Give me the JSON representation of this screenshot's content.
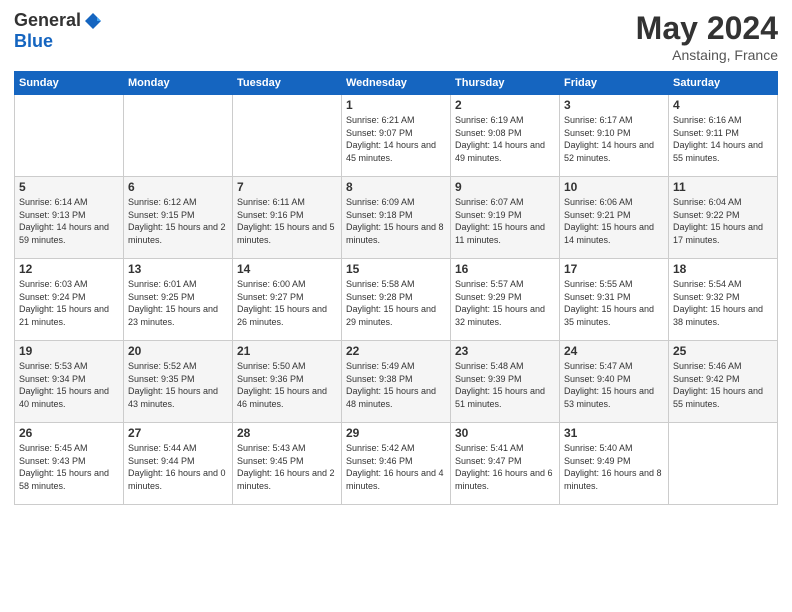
{
  "header": {
    "logo_general": "General",
    "logo_blue": "Blue",
    "title": "May 2024",
    "location": "Anstaing, France"
  },
  "days_of_week": [
    "Sunday",
    "Monday",
    "Tuesday",
    "Wednesday",
    "Thursday",
    "Friday",
    "Saturday"
  ],
  "weeks": [
    [
      {
        "day": "",
        "info": ""
      },
      {
        "day": "",
        "info": ""
      },
      {
        "day": "",
        "info": ""
      },
      {
        "day": "1",
        "info": "Sunrise: 6:21 AM\nSunset: 9:07 PM\nDaylight: 14 hours\nand 45 minutes."
      },
      {
        "day": "2",
        "info": "Sunrise: 6:19 AM\nSunset: 9:08 PM\nDaylight: 14 hours\nand 49 minutes."
      },
      {
        "day": "3",
        "info": "Sunrise: 6:17 AM\nSunset: 9:10 PM\nDaylight: 14 hours\nand 52 minutes."
      },
      {
        "day": "4",
        "info": "Sunrise: 6:16 AM\nSunset: 9:11 PM\nDaylight: 14 hours\nand 55 minutes."
      }
    ],
    [
      {
        "day": "5",
        "info": "Sunrise: 6:14 AM\nSunset: 9:13 PM\nDaylight: 14 hours\nand 59 minutes."
      },
      {
        "day": "6",
        "info": "Sunrise: 6:12 AM\nSunset: 9:15 PM\nDaylight: 15 hours\nand 2 minutes."
      },
      {
        "day": "7",
        "info": "Sunrise: 6:11 AM\nSunset: 9:16 PM\nDaylight: 15 hours\nand 5 minutes."
      },
      {
        "day": "8",
        "info": "Sunrise: 6:09 AM\nSunset: 9:18 PM\nDaylight: 15 hours\nand 8 minutes."
      },
      {
        "day": "9",
        "info": "Sunrise: 6:07 AM\nSunset: 9:19 PM\nDaylight: 15 hours\nand 11 minutes."
      },
      {
        "day": "10",
        "info": "Sunrise: 6:06 AM\nSunset: 9:21 PM\nDaylight: 15 hours\nand 14 minutes."
      },
      {
        "day": "11",
        "info": "Sunrise: 6:04 AM\nSunset: 9:22 PM\nDaylight: 15 hours\nand 17 minutes."
      }
    ],
    [
      {
        "day": "12",
        "info": "Sunrise: 6:03 AM\nSunset: 9:24 PM\nDaylight: 15 hours\nand 21 minutes."
      },
      {
        "day": "13",
        "info": "Sunrise: 6:01 AM\nSunset: 9:25 PM\nDaylight: 15 hours\nand 23 minutes."
      },
      {
        "day": "14",
        "info": "Sunrise: 6:00 AM\nSunset: 9:27 PM\nDaylight: 15 hours\nand 26 minutes."
      },
      {
        "day": "15",
        "info": "Sunrise: 5:58 AM\nSunset: 9:28 PM\nDaylight: 15 hours\nand 29 minutes."
      },
      {
        "day": "16",
        "info": "Sunrise: 5:57 AM\nSunset: 9:29 PM\nDaylight: 15 hours\nand 32 minutes."
      },
      {
        "day": "17",
        "info": "Sunrise: 5:55 AM\nSunset: 9:31 PM\nDaylight: 15 hours\nand 35 minutes."
      },
      {
        "day": "18",
        "info": "Sunrise: 5:54 AM\nSunset: 9:32 PM\nDaylight: 15 hours\nand 38 minutes."
      }
    ],
    [
      {
        "day": "19",
        "info": "Sunrise: 5:53 AM\nSunset: 9:34 PM\nDaylight: 15 hours\nand 40 minutes."
      },
      {
        "day": "20",
        "info": "Sunrise: 5:52 AM\nSunset: 9:35 PM\nDaylight: 15 hours\nand 43 minutes."
      },
      {
        "day": "21",
        "info": "Sunrise: 5:50 AM\nSunset: 9:36 PM\nDaylight: 15 hours\nand 46 minutes."
      },
      {
        "day": "22",
        "info": "Sunrise: 5:49 AM\nSunset: 9:38 PM\nDaylight: 15 hours\nand 48 minutes."
      },
      {
        "day": "23",
        "info": "Sunrise: 5:48 AM\nSunset: 9:39 PM\nDaylight: 15 hours\nand 51 minutes."
      },
      {
        "day": "24",
        "info": "Sunrise: 5:47 AM\nSunset: 9:40 PM\nDaylight: 15 hours\nand 53 minutes."
      },
      {
        "day": "25",
        "info": "Sunrise: 5:46 AM\nSunset: 9:42 PM\nDaylight: 15 hours\nand 55 minutes."
      }
    ],
    [
      {
        "day": "26",
        "info": "Sunrise: 5:45 AM\nSunset: 9:43 PM\nDaylight: 15 hours\nand 58 minutes."
      },
      {
        "day": "27",
        "info": "Sunrise: 5:44 AM\nSunset: 9:44 PM\nDaylight: 16 hours\nand 0 minutes."
      },
      {
        "day": "28",
        "info": "Sunrise: 5:43 AM\nSunset: 9:45 PM\nDaylight: 16 hours\nand 2 minutes."
      },
      {
        "day": "29",
        "info": "Sunrise: 5:42 AM\nSunset: 9:46 PM\nDaylight: 16 hours\nand 4 minutes."
      },
      {
        "day": "30",
        "info": "Sunrise: 5:41 AM\nSunset: 9:47 PM\nDaylight: 16 hours\nand 6 minutes."
      },
      {
        "day": "31",
        "info": "Sunrise: 5:40 AM\nSunset: 9:49 PM\nDaylight: 16 hours\nand 8 minutes."
      },
      {
        "day": "",
        "info": ""
      }
    ]
  ]
}
